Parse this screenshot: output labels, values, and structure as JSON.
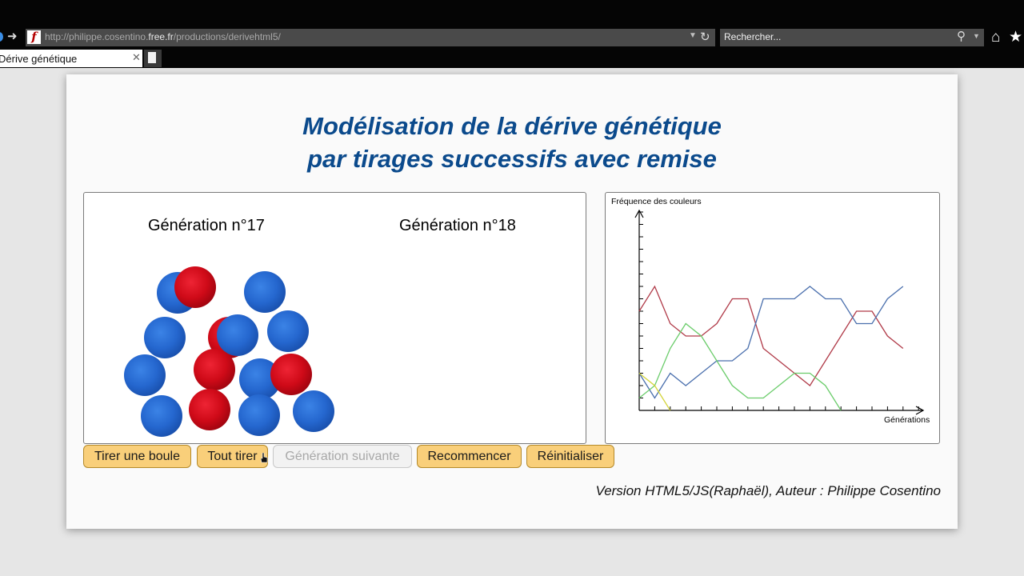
{
  "browser": {
    "url_prefix": "http://philippe.cosentino.",
    "url_domain": "free.fr",
    "url_suffix": "/productions/derivehtml5/",
    "search_placeholder": "Rechercher...",
    "tab_title": "Dérive génétique",
    "favicon_letter": "f",
    "icons": [
      "back-icon",
      "forward-icon",
      "refresh-icon",
      "search-icon",
      "home-icon",
      "star-icon",
      "close-icon",
      "new-tab-icon"
    ]
  },
  "page": {
    "title_line1": "Modélisation de la dérive génétique",
    "title_line2": "par tirages successifs avec remise",
    "gen_current": "Génération n°17",
    "gen_next": "Génération n°18",
    "footer": "Version HTML5/JS(Raphaël), Auteur : Philippe Cosentino"
  },
  "balls_current": {
    "colors": {
      "blue": "#2567cf",
      "red": "#cf0a18"
    },
    "count": 15,
    "blue": 10,
    "red": 5
  },
  "buttons": [
    {
      "id": "tirer-une-boule",
      "label": "Tirer une boule",
      "enabled": true
    },
    {
      "id": "tout-tirer",
      "label": "Tout tirer",
      "enabled": true
    },
    {
      "id": "generation-suivante",
      "label": "Génération suivante",
      "enabled": false
    },
    {
      "id": "recommencer",
      "label": "Recommencer",
      "enabled": true
    },
    {
      "id": "reinitialiser",
      "label": "Réinitialiser",
      "enabled": true
    }
  ],
  "chart_data": {
    "type": "line",
    "title": "",
    "ylabel": "Fréquence des couleurs",
    "xlabel": "Générations",
    "x": [
      0,
      1,
      2,
      3,
      4,
      5,
      6,
      7,
      8,
      9,
      10,
      11,
      12,
      13,
      14,
      15,
      16,
      17
    ],
    "xlim": [
      0,
      18
    ],
    "ylim": [
      0,
      16
    ],
    "grid": false,
    "series": [
      {
        "color": "#b03a48",
        "values": [
          8,
          10,
          7,
          6,
          6,
          7,
          9,
          9,
          5,
          4,
          3,
          2,
          4,
          6,
          8,
          8,
          6,
          5
        ]
      },
      {
        "color": "#4a6fad",
        "values": [
          3,
          1,
          3,
          2,
          3,
          4,
          4,
          5,
          9,
          9,
          9,
          10,
          9,
          9,
          7,
          7,
          9,
          10
        ]
      },
      {
        "color": "#6acc6a",
        "values": [
          1,
          2,
          5,
          7,
          6,
          4,
          2,
          1,
          1,
          2,
          3,
          3,
          2,
          0
        ]
      },
      {
        "color": "#d4d43a",
        "values": [
          3,
          2,
          0
        ]
      }
    ]
  }
}
